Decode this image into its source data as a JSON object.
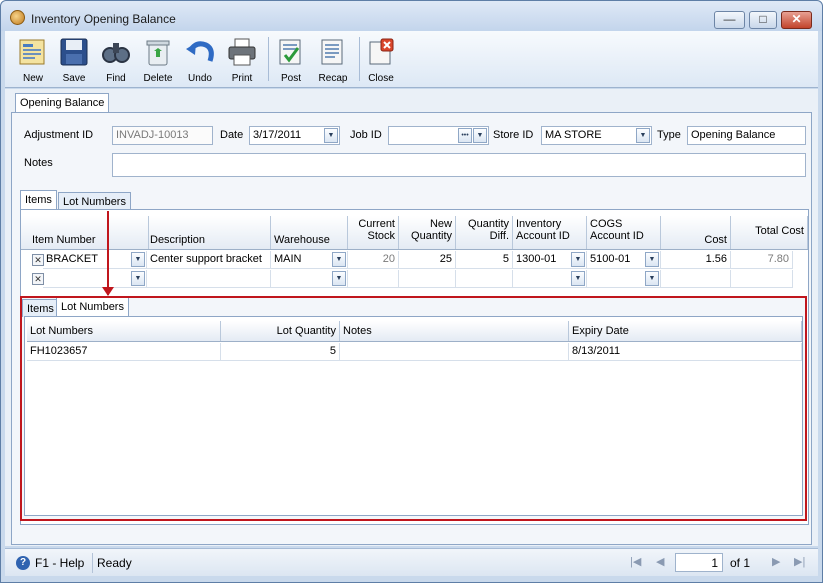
{
  "window": {
    "title": "Inventory Opening Balance",
    "min_label": "—",
    "max_label": "□",
    "close_label": "✕"
  },
  "toolbar": {
    "buttons": [
      {
        "label": "New",
        "icon": "new-icon"
      },
      {
        "label": "Save",
        "icon": "save-icon"
      },
      {
        "label": "Find",
        "icon": "find-icon"
      },
      {
        "label": "Delete",
        "icon": "delete-icon"
      },
      {
        "label": "Undo",
        "icon": "undo-icon"
      },
      {
        "label": "Print",
        "icon": "print-icon"
      },
      {
        "label": "Post",
        "icon": "post-icon"
      },
      {
        "label": "Recap",
        "icon": "recap-icon"
      },
      {
        "label": "Close",
        "icon": "close-icon"
      }
    ]
  },
  "main_tab": "Opening Balance",
  "form": {
    "adjustment_id_label": "Adjustment ID",
    "adjustment_id_value": "INVADJ-10013",
    "date_label": "Date",
    "date_value": "3/17/2011",
    "job_id_label": "Job ID",
    "job_id_value": "",
    "store_id_label": "Store ID",
    "store_id_value": "MA STORE",
    "type_label": "Type",
    "type_value": "Opening Balance",
    "notes_label": "Notes",
    "notes_value": ""
  },
  "detail_tabs": [
    "Items",
    "Lot Numbers"
  ],
  "items_grid": {
    "headers": {
      "item_number": "Item Number",
      "description": "Description",
      "warehouse": "Warehouse",
      "current_stock_1": "Current",
      "current_stock_2": "Stock",
      "new_qty_1": "New",
      "new_qty_2": "Quantity",
      "qty_diff_1": "Quantity",
      "qty_diff_2": "Diff.",
      "inv_acct_1": "Inventory",
      "inv_acct_2": "Account ID",
      "cogs_1": "COGS",
      "cogs_2": "Account ID",
      "cost": "Cost",
      "total_cost": "Total Cost"
    },
    "row": {
      "item_number": "BRACKET",
      "description": "Center support bracket",
      "warehouse": "MAIN",
      "current_stock": "20",
      "new_quantity": "25",
      "quantity_diff": "5",
      "inventory_account": "1300-01",
      "cogs_account": "5100-01",
      "cost": "1.56",
      "total_cost": "7.80"
    }
  },
  "lot_tabs": [
    "Items",
    "Lot Numbers"
  ],
  "lot_grid": {
    "headers": {
      "lot_numbers": "Lot Numbers",
      "lot_quantity": "Lot Quantity",
      "notes": "Notes",
      "expiry_date": "Expiry Date"
    },
    "row": {
      "lot_number": "FH1023657",
      "lot_quantity": "5",
      "notes": "",
      "expiry_date": "8/13/2011"
    }
  },
  "statusbar": {
    "help": "F1 - Help",
    "status": "Ready",
    "page": "1",
    "of_label": "of 1"
  },
  "colors": {
    "accent_red": "#c0161d",
    "frame": "#c9d9ec"
  }
}
